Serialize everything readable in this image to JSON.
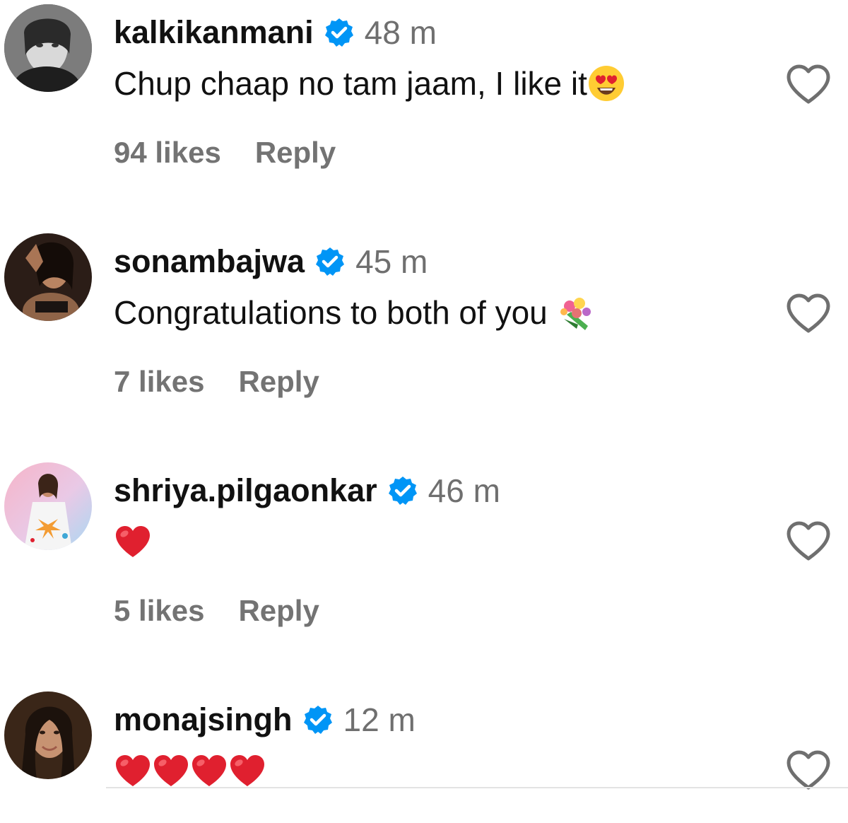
{
  "comments": [
    {
      "username": "kalkikanmani",
      "time": "48 m",
      "text": "Chup chaap no tam jaam, I like it",
      "emoji": "smiling-face-with-heart-eyes",
      "likes": "94 likes",
      "reply_label": "Reply"
    },
    {
      "username": "sonambajwa",
      "time": "45 m",
      "text": "Congratulations to both of you ",
      "emoji": "bouquet",
      "likes": "7 likes",
      "reply_label": "Reply"
    },
    {
      "username": "shriya.pilgaonkar",
      "time": "46 m",
      "text": "",
      "emoji": "red-heart",
      "likes": "5 likes",
      "reply_label": "Reply"
    },
    {
      "username": "monajsingh",
      "time": "12 m",
      "text": "",
      "emoji": "red-heart x4"
    }
  ],
  "colors": {
    "verified_badge": "#0095f6",
    "secondary_text": "#737373",
    "heart_emoji": "#e0202f"
  }
}
